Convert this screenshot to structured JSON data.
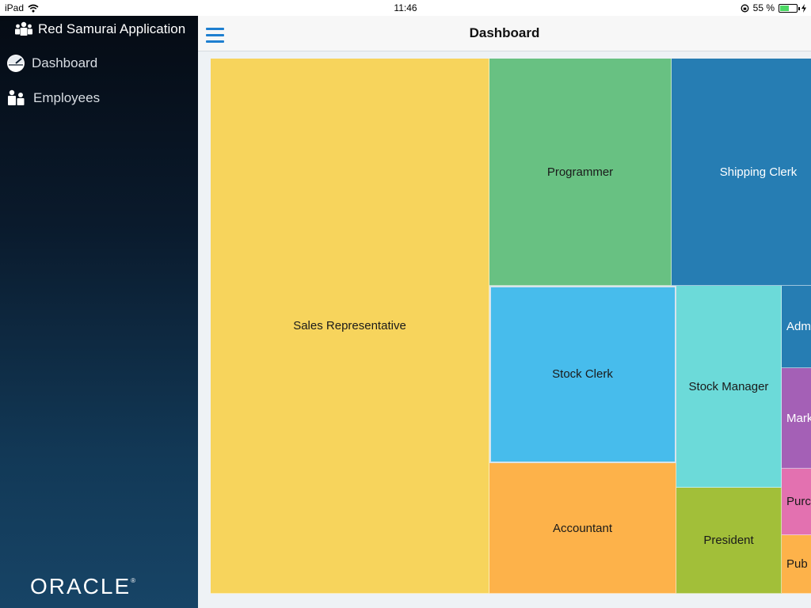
{
  "status_bar": {
    "device": "iPad",
    "time": "11:46",
    "battery": "55 %",
    "battery_level": 0.55
  },
  "sidebar": {
    "app_title": "Red Samurai Application",
    "items": [
      {
        "label": "Dashboard",
        "icon": "dashboard-icon"
      },
      {
        "label": "Employees",
        "icon": "people-icon"
      }
    ],
    "logo": "ORACLE"
  },
  "header": {
    "title": "Dashboard",
    "menu_icon": "hamburger-icon"
  },
  "treemap": {
    "tiles": [
      {
        "label": "Sales Representative",
        "color": "#f7d45c"
      },
      {
        "label": "Programmer",
        "color": "#68c182"
      },
      {
        "label": "Shipping Clerk",
        "color": "#267db3",
        "light": true
      },
      {
        "label": "Stock Clerk",
        "color": "#47bcec",
        "selected": true
      },
      {
        "label": "Accountant",
        "color": "#fdb24a"
      },
      {
        "label": "Stock Manager",
        "color": "#6cdad9"
      },
      {
        "label": "President",
        "color": "#a2bf39"
      },
      {
        "label": "Adm",
        "color": "#267db3",
        "light": true
      },
      {
        "label": "Mark",
        "color": "#a460b6",
        "light": true
      },
      {
        "label": "Purc",
        "color": "#e371b0"
      },
      {
        "label": "Pub",
        "color": "#fdb24a"
      }
    ]
  }
}
